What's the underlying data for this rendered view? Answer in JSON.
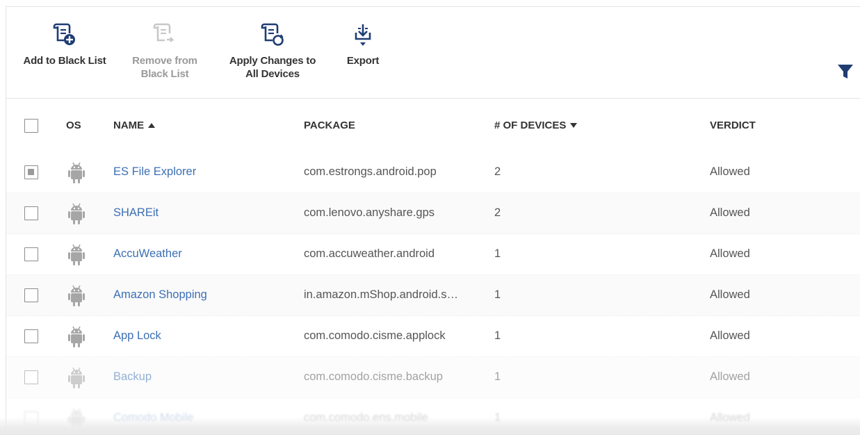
{
  "toolbar": {
    "add_label": "Add to Black List",
    "remove_label": "Remove from\nBlack List",
    "apply_label": "Apply Changes to\nAll Devices",
    "export_label": "Export"
  },
  "table": {
    "headers": {
      "os": "OS",
      "name": "NAME",
      "package": "PACKAGE",
      "devices": "# OF DEVICES",
      "verdict": "VERDICT"
    },
    "rows": [
      {
        "name": "ES File Explorer",
        "package": "com.estrongs.android.pop",
        "devices": "2",
        "verdict": "Allowed",
        "checked": true
      },
      {
        "name": "SHAREit",
        "package": "com.lenovo.anyshare.gps",
        "devices": "2",
        "verdict": "Allowed",
        "checked": false
      },
      {
        "name": "AccuWeather",
        "package": "com.accuweather.android",
        "devices": "1",
        "verdict": "Allowed",
        "checked": false
      },
      {
        "name": "Amazon Shopping",
        "package": "in.amazon.mShop.android.s…",
        "devices": "1",
        "verdict": "Allowed",
        "checked": false
      },
      {
        "name": "App Lock",
        "package": "com.comodo.cisme.applock",
        "devices": "1",
        "verdict": "Allowed",
        "checked": false
      },
      {
        "name": "Backup",
        "package": "com.comodo.cisme.backup",
        "devices": "1",
        "verdict": "Allowed",
        "checked": false
      },
      {
        "name": "Comodo Mobile",
        "package": "com.comodo.ens.mobile",
        "devices": "1",
        "verdict": "Allowed",
        "checked": false
      }
    ]
  },
  "colors": {
    "link": "#3c6fb5",
    "icon": "#1f3d73",
    "android": "#a6a6a6"
  },
  "icons": {
    "add": "document-add-icon",
    "remove": "document-remove-icon",
    "apply": "document-sync-icon",
    "export": "download-icon",
    "filter": "filter-icon",
    "os": "android-icon"
  }
}
